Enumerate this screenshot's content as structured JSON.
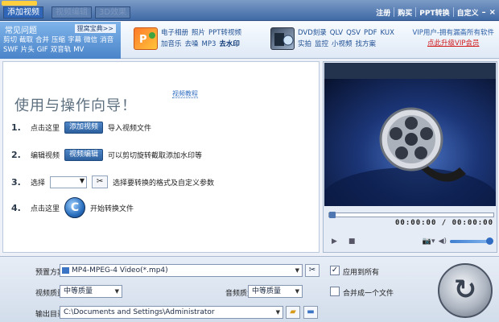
{
  "titlebar": {
    "tabs": [
      "添加视频",
      "视频编辑",
      "3D效果"
    ],
    "right_links": [
      "注册",
      "购买",
      "PPT转换",
      "自定义"
    ],
    "window_controls": [
      "–",
      "×"
    ]
  },
  "toolbar": {
    "faq_title": "常见问题",
    "faq_more": "狸窝宝典>>",
    "faq_links": [
      "剪切",
      "截取",
      "合并",
      "压缩",
      "字幕",
      "微信",
      "消音",
      "SWF",
      "片头",
      "GIF",
      "双音轨",
      "MV"
    ],
    "group1": [
      "电子相册",
      "照片",
      "PPT转视频",
      "加音乐",
      "去噪",
      "MP3",
      "去水印"
    ],
    "group2": [
      "DVD刻录",
      "QLV",
      "QSV",
      "PDF",
      "KUX",
      "实拍",
      "监控",
      "小视频",
      "找方案"
    ],
    "vip_text": "VIP用户-拥有漏斋所有软件",
    "vip_upgrade": "点此升级VIP会员"
  },
  "guide": {
    "title": "使用与操作向导！",
    "badge": "视频教程",
    "steps": [
      {
        "num": "1.",
        "pre": "点击这里",
        "mid": "添加视频",
        "post": "导入视频文件"
      },
      {
        "num": "2.",
        "pre": "编辑视频",
        "mid": "视频编辑",
        "post": "可以剪切旋转截取添加水印等"
      },
      {
        "num": "3.",
        "pre": "选择",
        "mid": "",
        "post": "选择要转换的格式及自定义参数"
      },
      {
        "num": "4.",
        "pre": "点击这里",
        "mid": "C",
        "post": "开始转换文件"
      }
    ]
  },
  "preview": {
    "time_current": "00:00:00",
    "time_sep": "/",
    "time_total": "00:00:00",
    "volume": 0.85
  },
  "output": {
    "preset_label": "预置方案：",
    "preset_value": "MP4-MPEG-4 Video(*.mp4)",
    "video_quality_label": "视频质量：",
    "video_quality": "中等质量",
    "audio_quality_label": "音频质量：",
    "audio_quality": "中等质量",
    "output_dir_label": "输出目录：",
    "output_dir": "C:\\Documents and Settings\\Administrator",
    "apply_all_label": "应用到所有",
    "merge_label": "合并成一个文件",
    "apply_all_checked": true,
    "merge_checked": false
  },
  "colors": {
    "accent": "#2f66b7",
    "vip_red": "#d21a1a"
  }
}
